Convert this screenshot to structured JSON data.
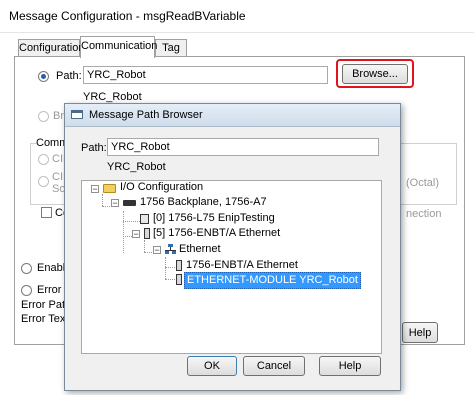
{
  "outer": {
    "title": "Message Configuration - msgReadBVariable",
    "tabs": [
      "Configuration",
      "Communication",
      "Tag"
    ],
    "path_label": "Path:",
    "path_value": "YRC_Robot",
    "path_display": "YRC_Robot",
    "browse_label": "Browse...",
    "bro_partial": "Bro",
    "commu_partial": "Commu",
    "cip_partial": "CIP",
    "cip2_partial": "CIP",
    "sou_partial": "Sou",
    "co_partial": "Co",
    "octal_text": "(Octal)",
    "nection_text": "nection",
    "enable_partial": "Enable",
    "error_partial": "Error C",
    "error_path_label": "Error Path:",
    "error_text_label": "Error Text:",
    "help_label": "Help"
  },
  "browser": {
    "title": "Message Path Browser",
    "path_label": "Path:",
    "path_value": "YRC_Robot",
    "path_display": "YRC_Robot",
    "tree": {
      "io_config": "I/O Configuration",
      "backplane": "1756 Backplane, 1756-A7",
      "slot0": "[0] 1756-L75 EnipTesting",
      "slot5": "[5] 1756-ENBT/A Ethernet",
      "ethernet": "Ethernet",
      "enbt": "1756-ENBT/A Ethernet",
      "module": "ETHERNET-MODULE YRC_Robot"
    },
    "ok_label": "OK",
    "cancel_label": "Cancel",
    "help_label": "Help"
  },
  "colors": {
    "highlight": "#3399ff",
    "annotation_red": "#e0141e",
    "title_bar": "#d7e4f2"
  }
}
